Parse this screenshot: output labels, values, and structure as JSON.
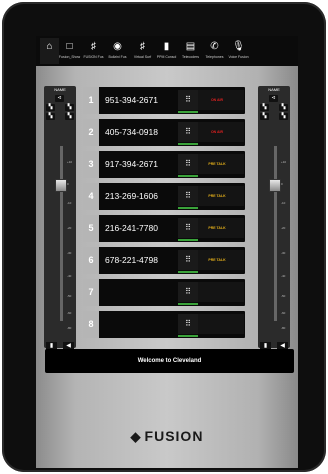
{
  "nav": [
    {
      "label": "Home",
      "icon": "home-icon",
      "glyph": "⌂"
    },
    {
      "label": "Fusion_Show",
      "icon": "window-icon",
      "glyph": "□"
    },
    {
      "label": "FUSION Fus",
      "icon": "mixer-icon",
      "glyph": "♯"
    },
    {
      "label": "Bullzini Fus",
      "icon": "target-icon",
      "glyph": "◉"
    },
    {
      "label": "Virtual Surf",
      "icon": "faders-icon",
      "glyph": "♯"
    },
    {
      "label": "PPM Consol",
      "icon": "meter-icon",
      "glyph": "▮"
    },
    {
      "label": "Telecoders",
      "icon": "codec-icon",
      "glyph": "▤"
    },
    {
      "label": "Telephones",
      "icon": "phone-icon",
      "glyph": "✆"
    },
    {
      "label": "Voice Fusion",
      "icon": "mic-icon",
      "glyph": "🎙"
    }
  ],
  "left_panel": {
    "title": "NAME",
    "off_label": "OFF",
    "scale": [
      "+10",
      "0",
      "-10",
      "-20",
      "-30",
      "-40",
      "-50",
      "-60",
      "-80"
    ]
  },
  "right_panel": {
    "title": "NAME",
    "off_label": "OFF",
    "scale": [
      "+10",
      "0",
      "-10",
      "-20",
      "-30",
      "-40",
      "-50",
      "-60",
      "-80"
    ]
  },
  "lines": [
    {
      "num": "1",
      "phone": "951-394-2671",
      "status": "ON AIR",
      "kind": "onair"
    },
    {
      "num": "2",
      "phone": "405-734-0918",
      "status": "ON AIR",
      "kind": "onair"
    },
    {
      "num": "3",
      "phone": "917-394-2671",
      "status": "PRE TALK",
      "kind": "pre"
    },
    {
      "num": "4",
      "phone": "213-269-1606",
      "status": "PRE TALK",
      "kind": "pre"
    },
    {
      "num": "5",
      "phone": "216-241-7780",
      "status": "PRE TALK",
      "kind": "pre"
    },
    {
      "num": "6",
      "phone": "678-221-4798",
      "status": "PRE TALK",
      "kind": "pre"
    },
    {
      "num": "7",
      "phone": "",
      "status": "",
      "kind": "none"
    },
    {
      "num": "8",
      "phone": "",
      "status": "",
      "kind": "none"
    }
  ],
  "welcome": "Welcome to Cleveland",
  "brand": "FUSION",
  "colors": {
    "onair": "#e02020",
    "pretalk": "#e8b21a",
    "meter": "#3aa33a"
  }
}
